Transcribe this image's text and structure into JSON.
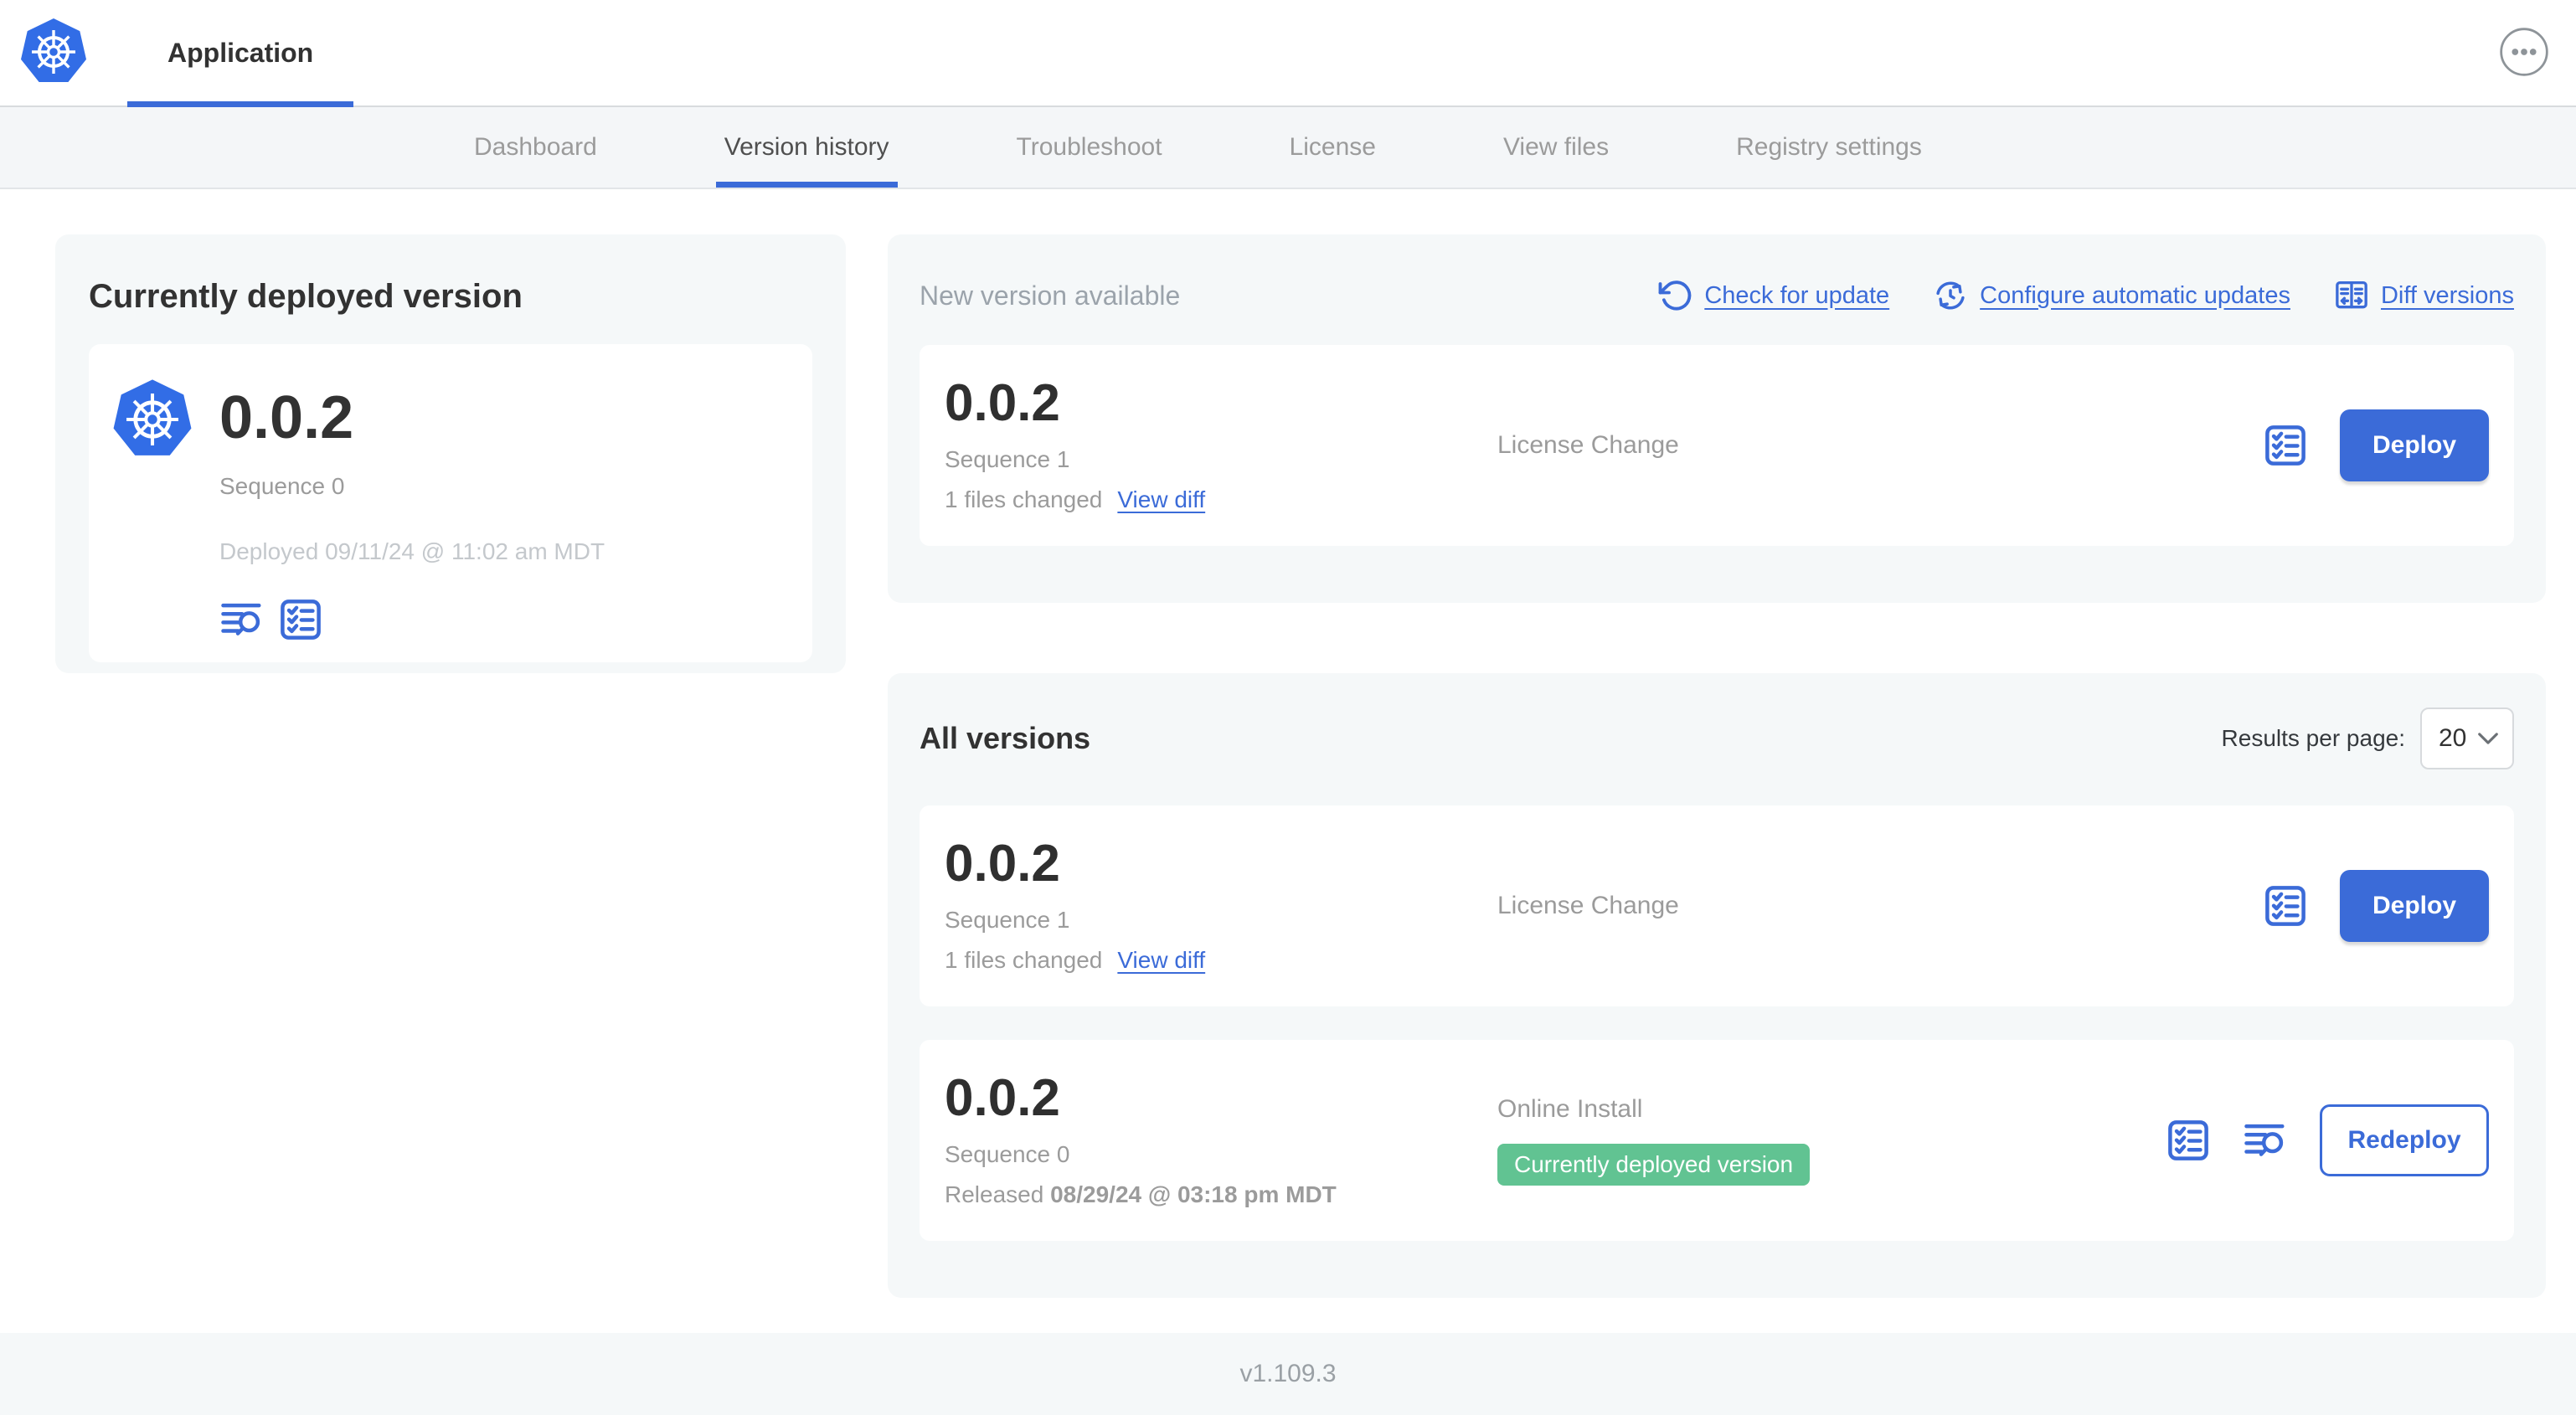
{
  "header": {
    "app_label": "Application"
  },
  "nav": {
    "tabs": [
      "Dashboard",
      "Version history",
      "Troubleshoot",
      "License",
      "View files",
      "Registry settings"
    ],
    "active_tab": "Version history"
  },
  "current": {
    "title": "Currently deployed version",
    "version": "0.0.2",
    "sequence": "Sequence 0",
    "deployed": "Deployed 09/11/24 @ 11:02 am MDT"
  },
  "newVersion": {
    "title": "New version available",
    "links": {
      "check": "Check for update",
      "configure": "Configure automatic updates",
      "diff": "Diff versions"
    },
    "row": {
      "version": "0.0.2",
      "sequence": "Sequence 1",
      "files_changed": "1 files changed",
      "view_diff": "View diff",
      "source": "License Change",
      "action": "Deploy"
    }
  },
  "allVersions": {
    "title": "All versions",
    "results_label": "Results per page:",
    "results_value": "20",
    "rows": [
      {
        "version": "0.0.2",
        "sequence": "Sequence 1",
        "files_changed": "1 files changed",
        "view_diff": "View diff",
        "source": "License Change",
        "action": "Deploy"
      },
      {
        "version": "0.0.2",
        "sequence": "Sequence 0",
        "released_prefix": "Released",
        "released_date": "08/29/24 @ 03:18 pm MDT",
        "source": "Online Install",
        "badge": "Currently deployed version",
        "action": "Redeploy"
      }
    ]
  },
  "footer": {
    "version": "v1.109.3"
  },
  "colors": {
    "accent": "#3b6bd8",
    "kubernetes_blue": "#326de6",
    "badge_green": "#61c392"
  }
}
